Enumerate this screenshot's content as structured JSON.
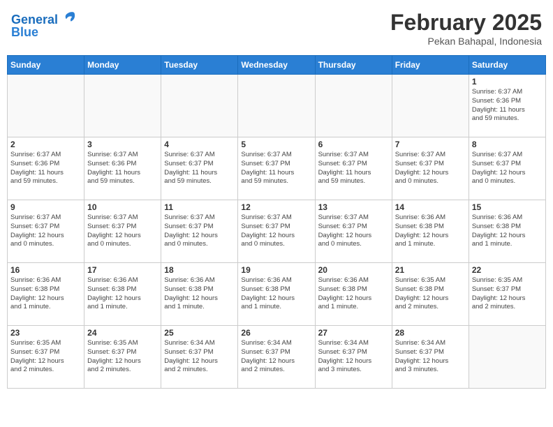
{
  "header": {
    "logo_line1": "General",
    "logo_line2": "Blue",
    "title": "February 2025",
    "subtitle": "Pekan Bahapal, Indonesia"
  },
  "days_of_week": [
    "Sunday",
    "Monday",
    "Tuesday",
    "Wednesday",
    "Thursday",
    "Friday",
    "Saturday"
  ],
  "weeks": [
    [
      {
        "day": "",
        "info": ""
      },
      {
        "day": "",
        "info": ""
      },
      {
        "day": "",
        "info": ""
      },
      {
        "day": "",
        "info": ""
      },
      {
        "day": "",
        "info": ""
      },
      {
        "day": "",
        "info": ""
      },
      {
        "day": "1",
        "info": "Sunrise: 6:37 AM\nSunset: 6:36 PM\nDaylight: 11 hours\nand 59 minutes."
      }
    ],
    [
      {
        "day": "2",
        "info": "Sunrise: 6:37 AM\nSunset: 6:36 PM\nDaylight: 11 hours\nand 59 minutes."
      },
      {
        "day": "3",
        "info": "Sunrise: 6:37 AM\nSunset: 6:36 PM\nDaylight: 11 hours\nand 59 minutes."
      },
      {
        "day": "4",
        "info": "Sunrise: 6:37 AM\nSunset: 6:37 PM\nDaylight: 11 hours\nand 59 minutes."
      },
      {
        "day": "5",
        "info": "Sunrise: 6:37 AM\nSunset: 6:37 PM\nDaylight: 11 hours\nand 59 minutes."
      },
      {
        "day": "6",
        "info": "Sunrise: 6:37 AM\nSunset: 6:37 PM\nDaylight: 11 hours\nand 59 minutes."
      },
      {
        "day": "7",
        "info": "Sunrise: 6:37 AM\nSunset: 6:37 PM\nDaylight: 12 hours\nand 0 minutes."
      },
      {
        "day": "8",
        "info": "Sunrise: 6:37 AM\nSunset: 6:37 PM\nDaylight: 12 hours\nand 0 minutes."
      }
    ],
    [
      {
        "day": "9",
        "info": "Sunrise: 6:37 AM\nSunset: 6:37 PM\nDaylight: 12 hours\nand 0 minutes."
      },
      {
        "day": "10",
        "info": "Sunrise: 6:37 AM\nSunset: 6:37 PM\nDaylight: 12 hours\nand 0 minutes."
      },
      {
        "day": "11",
        "info": "Sunrise: 6:37 AM\nSunset: 6:37 PM\nDaylight: 12 hours\nand 0 minutes."
      },
      {
        "day": "12",
        "info": "Sunrise: 6:37 AM\nSunset: 6:37 PM\nDaylight: 12 hours\nand 0 minutes."
      },
      {
        "day": "13",
        "info": "Sunrise: 6:37 AM\nSunset: 6:37 PM\nDaylight: 12 hours\nand 0 minutes."
      },
      {
        "day": "14",
        "info": "Sunrise: 6:36 AM\nSunset: 6:38 PM\nDaylight: 12 hours\nand 1 minute."
      },
      {
        "day": "15",
        "info": "Sunrise: 6:36 AM\nSunset: 6:38 PM\nDaylight: 12 hours\nand 1 minute."
      }
    ],
    [
      {
        "day": "16",
        "info": "Sunrise: 6:36 AM\nSunset: 6:38 PM\nDaylight: 12 hours\nand 1 minute."
      },
      {
        "day": "17",
        "info": "Sunrise: 6:36 AM\nSunset: 6:38 PM\nDaylight: 12 hours\nand 1 minute."
      },
      {
        "day": "18",
        "info": "Sunrise: 6:36 AM\nSunset: 6:38 PM\nDaylight: 12 hours\nand 1 minute."
      },
      {
        "day": "19",
        "info": "Sunrise: 6:36 AM\nSunset: 6:38 PM\nDaylight: 12 hours\nand 1 minute."
      },
      {
        "day": "20",
        "info": "Sunrise: 6:36 AM\nSunset: 6:38 PM\nDaylight: 12 hours\nand 1 minute."
      },
      {
        "day": "21",
        "info": "Sunrise: 6:35 AM\nSunset: 6:38 PM\nDaylight: 12 hours\nand 2 minutes."
      },
      {
        "day": "22",
        "info": "Sunrise: 6:35 AM\nSunset: 6:37 PM\nDaylight: 12 hours\nand 2 minutes."
      }
    ],
    [
      {
        "day": "23",
        "info": "Sunrise: 6:35 AM\nSunset: 6:37 PM\nDaylight: 12 hours\nand 2 minutes."
      },
      {
        "day": "24",
        "info": "Sunrise: 6:35 AM\nSunset: 6:37 PM\nDaylight: 12 hours\nand 2 minutes."
      },
      {
        "day": "25",
        "info": "Sunrise: 6:34 AM\nSunset: 6:37 PM\nDaylight: 12 hours\nand 2 minutes."
      },
      {
        "day": "26",
        "info": "Sunrise: 6:34 AM\nSunset: 6:37 PM\nDaylight: 12 hours\nand 2 minutes."
      },
      {
        "day": "27",
        "info": "Sunrise: 6:34 AM\nSunset: 6:37 PM\nDaylight: 12 hours\nand 3 minutes."
      },
      {
        "day": "28",
        "info": "Sunrise: 6:34 AM\nSunset: 6:37 PM\nDaylight: 12 hours\nand 3 minutes."
      },
      {
        "day": "",
        "info": ""
      }
    ]
  ]
}
